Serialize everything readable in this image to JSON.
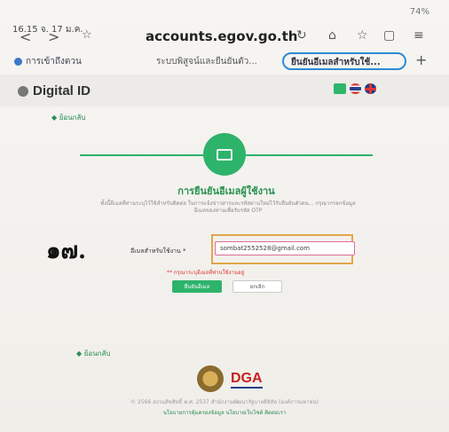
{
  "status_bar": {
    "time": "16.15 จ. 17 ม.ค.",
    "right": "74%"
  },
  "browser": {
    "url": "accounts.egov.go.th",
    "tabs": [
      {
        "label": "การเข้าถึงตวน"
      },
      {
        "label": "ระบบพิสูจน์และยืนยันตัว..."
      },
      {
        "label": "ยืนยันอีเมลสำหรับใช้..."
      }
    ]
  },
  "site": {
    "brand": "Digital ID",
    "back_top": "◆ ย้อนกลับ",
    "back_bottom": "◆ ย้อนกลับ"
  },
  "card": {
    "title": "การยืนยันอีเมลผู้ใช้งาน",
    "description": "ทั้งนี้อีเมลที่ท่านระบุไว้ใช้สำหรับติดต่อ ในการแจ้งข่าวสารและรหัสผ่านใหม่ไว้รับยืนยันตัวตน... กรุณากรอกข้อมูลอีเมลของท่านเพื่อรับรหัส OTP",
    "field_label": "อีเมลสำหรับใช้งาน *",
    "email_value": "sombat2552528@gmail.com",
    "hint": "** กรุณาระบุอีเมลที่ท่านใช้งานอยู่",
    "ok_label": "ยืนยันอีเมล",
    "cancel_label": "ยกเลิก"
  },
  "annotation": "๑๗.",
  "footer": {
    "logo_text": "DGA",
    "copyright": "© 2566 สงวนลิขสิทธิ์ พ.ศ. 2537 สำนักงานพัฒนารัฐบาลดิจิทัล (องค์การมหาชน)",
    "links": "นโยบายการคุ้มครองข้อมูล   นโยบายเว็บไซต์   ติดต่อเรา"
  },
  "colors": {
    "accent": "#2eb36b",
    "highlight": "#e3a64a",
    "dga": "#c8201f"
  }
}
